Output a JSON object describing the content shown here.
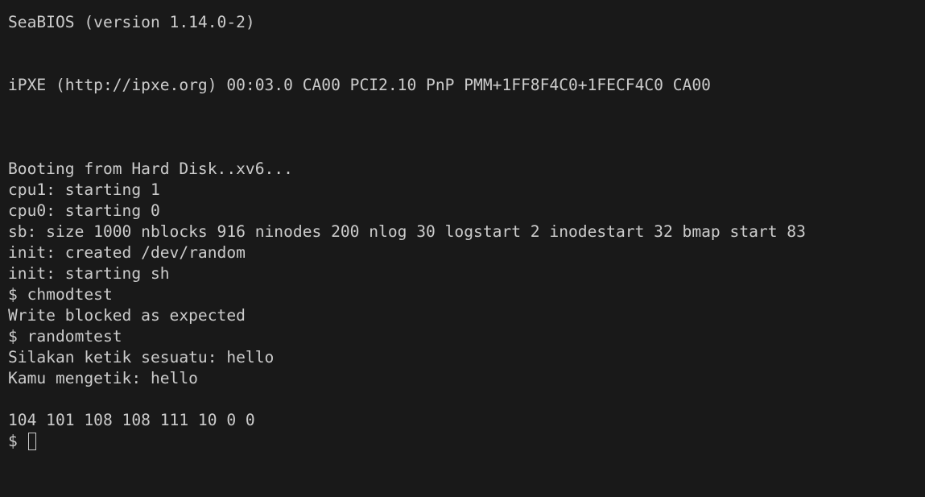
{
  "terminal": {
    "lines": [
      "SeaBIOS (version 1.14.0-2)",
      "iPXE (http://ipxe.org) 00:03.0 CA00 PCI2.10 PnP PMM+1FF8F4C0+1FECF4C0 CA00",
      "Booting from Hard Disk..xv6...",
      "cpu1: starting 1",
      "cpu0: starting 0",
      "sb: size 1000 nblocks 916 ninodes 200 nlog 30 logstart 2 inodestart 32 bmap start 83",
      "init: created /dev/random",
      "init: starting sh",
      "$ chmodtest",
      "Write blocked as expected",
      "$ randomtest",
      "Silakan ketik sesuatu: hello",
      "Kamu mengetik: hello",
      "104 101 108 108 111 10 0 0"
    ],
    "prompt": "$ "
  },
  "colors": {
    "background": "#191919",
    "text": "#cccccc"
  }
}
